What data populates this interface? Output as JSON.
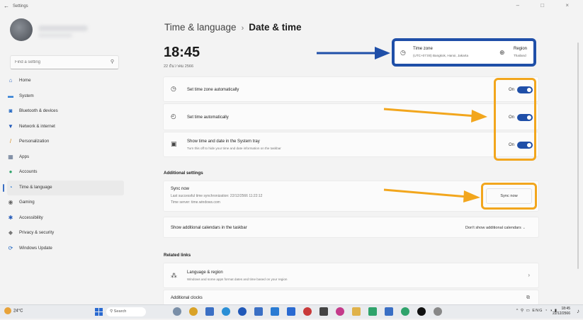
{
  "window": {
    "title": "Settings",
    "back_glyph": "←",
    "controls": "– □ ×"
  },
  "sidebar": {
    "search_placeholder": "Find a setting",
    "items": [
      {
        "label": "Home",
        "icon": "home-icon",
        "color": "#3a6fc4"
      },
      {
        "label": "System",
        "icon": "system-icon",
        "color": "#2a7bd3"
      },
      {
        "label": "Bluetooth & devices",
        "icon": "bluetooth-icon",
        "color": "#1a62c0"
      },
      {
        "label": "Network & internet",
        "icon": "wifi-icon",
        "color": "#2058b8"
      },
      {
        "label": "Personalization",
        "icon": "brush-icon",
        "color": "#d48a1e"
      },
      {
        "label": "Apps",
        "icon": "apps-icon",
        "color": "#5a6d8a"
      },
      {
        "label": "Accounts",
        "icon": "accounts-icon",
        "color": "#2fa36b"
      },
      {
        "label": "Time & language",
        "icon": "globe-clock-icon",
        "color": "#2a7bd3",
        "selected": true
      },
      {
        "label": "Gaming",
        "icon": "gamepad-icon",
        "color": "#666"
      },
      {
        "label": "Accessibility",
        "icon": "accessibility-icon",
        "color": "#2058b8"
      },
      {
        "label": "Privacy & security",
        "icon": "shield-icon",
        "color": "#777"
      },
      {
        "label": "Windows Update",
        "icon": "update-icon",
        "color": "#1a62c0"
      }
    ]
  },
  "header": {
    "parent": "Time & language",
    "separator": "›",
    "current": "Date & time"
  },
  "clock": {
    "time": "18:45",
    "date": "22 ธันวาคม 2566"
  },
  "timezone": {
    "title": "Time zone",
    "value": "(UTC+07:00) Bangkok, Hanoi, Jakarta",
    "region_title": "Region",
    "region_value": "Thailand"
  },
  "settings": {
    "tz_auto": {
      "label": "Set time zone automatically",
      "state": "On"
    },
    "time_auto": {
      "label": "Set time automatically",
      "state": "On"
    },
    "tray": {
      "label": "Show time and date in the System tray",
      "sub": "Turn this off to hide your time and date information on the taskbar",
      "state": "On"
    }
  },
  "additional": {
    "heading": "Additional settings",
    "sync_title": "Sync now",
    "sync_last": "Last successful time synchronization: 22/12/2566 11:22:12",
    "sync_server": "Time server: time.windows.com",
    "sync_button": "Sync now",
    "calendars_label": "Show additional calendars in the taskbar",
    "calendars_value": "Don't show additional calendars"
  },
  "related": {
    "heading": "Related links",
    "lang_title": "Language & region",
    "lang_sub": "Windows and some apps format dates and time based on your region",
    "clocks_title": "Additional clocks"
  },
  "taskbar": {
    "temp": "24°C",
    "search": "Search",
    "tray_lang": "ENG",
    "time": "18:45",
    "date": "22/12/2566"
  },
  "colors": {
    "accent": "#1f4fa8",
    "highlight_blue": "#1f4fa8",
    "highlight_orange": "#f2a61d"
  }
}
